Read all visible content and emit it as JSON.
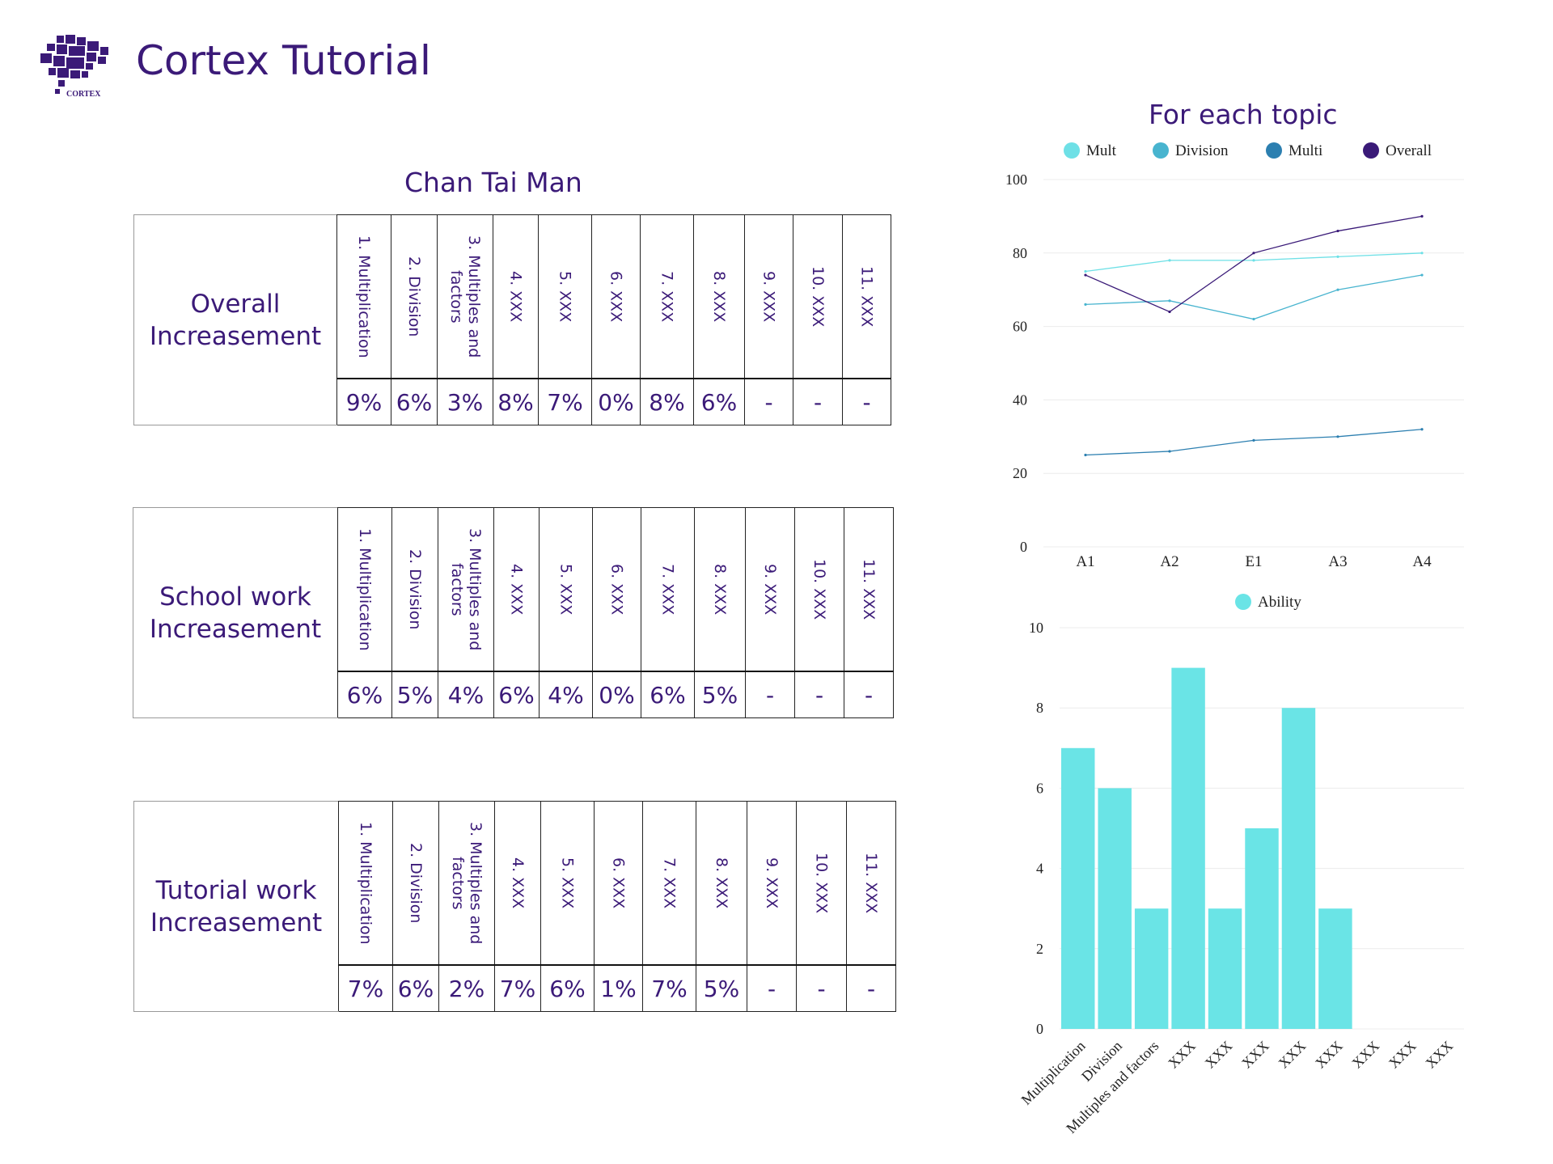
{
  "header": {
    "title": "Cortex Tutorial",
    "logo_text": "CORTEX"
  },
  "student": {
    "name": "Chan Tai Man"
  },
  "topics": [
    "1. Multiplication",
    "2. Division",
    "3. Multiples and factors",
    "4. XXX",
    "5. XXX",
    "6. XXX",
    "7. XXX",
    "8. XXX",
    "9. XXX",
    "10. XXX",
    "11. XXX"
  ],
  "tables": [
    {
      "title": "Overall Increasement",
      "values": [
        "9%",
        "6%",
        "3%",
        "8%",
        "7%",
        "0%",
        "8%",
        "6%",
        "-",
        "-",
        "-"
      ]
    },
    {
      "title": "School work Increasement",
      "values": [
        "6%",
        "5%",
        "4%",
        "6%",
        "4%",
        "0%",
        "6%",
        "5%",
        "-",
        "-",
        "-"
      ]
    },
    {
      "title": "Tutorial work Increasement",
      "values": [
        "7%",
        "6%",
        "2%",
        "7%",
        "6%",
        "1%",
        "7%",
        "5%",
        "-",
        "-",
        "-"
      ]
    }
  ],
  "chart_data": [
    {
      "type": "line",
      "title": "For each topic",
      "x": [
        "A1",
        "A2",
        "E1",
        "A3",
        "A4"
      ],
      "ylim": [
        0,
        100
      ],
      "yticks": [
        0,
        20,
        40,
        60,
        80,
        100
      ],
      "grid": true,
      "legend": "top",
      "series": [
        {
          "name": "Mult",
          "color": "#6ee0e6",
          "values": [
            75,
            78,
            78,
            79,
            80
          ]
        },
        {
          "name": "Division",
          "color": "#48b4cf",
          "values": [
            66,
            67,
            62,
            70,
            74
          ]
        },
        {
          "name": "Multi",
          "color": "#2c7fb0",
          "values": [
            25,
            26,
            29,
            30,
            32
          ]
        },
        {
          "name": "Overall",
          "color": "#3a1a78",
          "values": [
            74,
            64,
            80,
            86,
            90
          ]
        }
      ]
    },
    {
      "type": "bar",
      "categories": [
        "Multiplication",
        "Division",
        "Multiples and factors",
        "XXX",
        "XXX",
        "XXX",
        "XXX",
        "XXX",
        "XXX",
        "XXX",
        "XXX"
      ],
      "ylim": [
        0,
        10
      ],
      "yticks": [
        0,
        2,
        4,
        6,
        8,
        10
      ],
      "grid": true,
      "legend": "top",
      "series": [
        {
          "name": "Ability",
          "color": "#6ae4e6",
          "values": [
            7,
            6,
            3,
            9,
            3,
            5,
            8,
            3,
            null,
            null,
            null
          ]
        }
      ]
    }
  ]
}
